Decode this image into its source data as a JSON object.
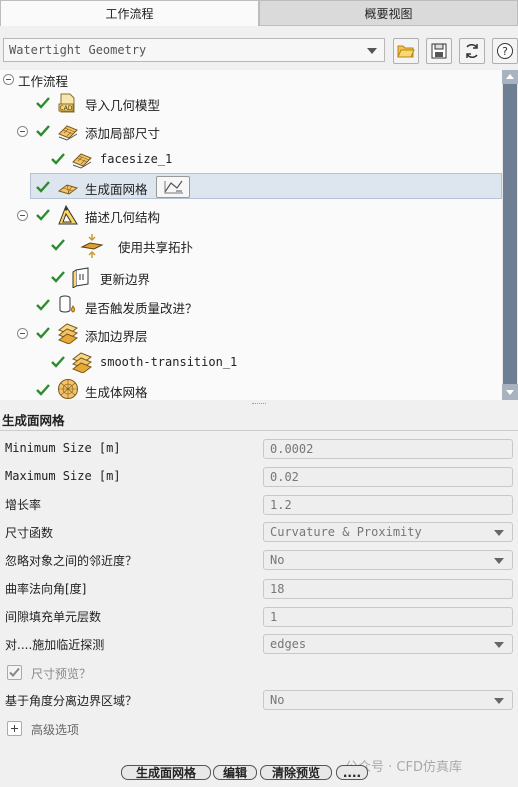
{
  "tabs": [
    {
      "label": "工作流程",
      "active": true
    },
    {
      "label": "概要视图",
      "active": false
    }
  ],
  "workflow_select": {
    "value": "Watertight Geometry"
  },
  "toolbar_icons": [
    "folder-open-icon",
    "save-icon",
    "refresh-icon",
    "help-icon"
  ],
  "tree": {
    "root": "工作流程",
    "items": [
      {
        "label": "导入几何模型",
        "icon": "cad-import-icon"
      },
      {
        "label": "添加局部尺寸",
        "icon": "local-size-icon"
      },
      {
        "label": "facesize_1",
        "icon": "local-size-icon"
      },
      {
        "label": "生成面网格",
        "icon": "surface-mesh-icon"
      },
      {
        "label": "描述几何结构",
        "icon": "describe-geometry-icon"
      },
      {
        "label": "使用共享拓扑",
        "icon": "share-topology-icon"
      },
      {
        "label": "更新边界",
        "icon": "update-boundaries-icon"
      },
      {
        "label": "是否触发质量改进？",
        "icon": "quality-improve-icon"
      },
      {
        "label": "添加边界层",
        "icon": "boundary-layer-icon"
      },
      {
        "label": "smooth-transition_1",
        "icon": "boundary-layer-icon"
      },
      {
        "label": "生成体网格",
        "icon": "volume-mesh-icon"
      }
    ]
  },
  "panel": {
    "title": "生成面网格",
    "props": [
      {
        "label": "Minimum Size [m]",
        "value": "0.0002",
        "dropdown": false
      },
      {
        "label": "Maximum Size [m]",
        "value": "0.02",
        "dropdown": false
      },
      {
        "label": "增长率",
        "value": "1.2",
        "dropdown": false
      },
      {
        "label": "尺寸函数",
        "value": "Curvature & Proximity",
        "dropdown": true
      },
      {
        "label": "忽略对象之间的邻近度？",
        "value": "No",
        "dropdown": true
      },
      {
        "label": "曲率法向角[度]",
        "value": "18",
        "dropdown": false
      },
      {
        "label": "间隙填充单元层数",
        "value": "1",
        "dropdown": false
      },
      {
        "label": "对....施加临近探测",
        "value": "edges",
        "dropdown": true
      }
    ],
    "size_preview_label": "尺寸预览？",
    "separate_label": "基于角度分离边界区域？",
    "separate_value": "No",
    "advanced_label": "高级选项"
  },
  "buttons": {
    "generate": "生成面网格",
    "edit": "编辑",
    "clear_preview": "清除预览",
    "more": "...."
  },
  "watermark": "公众号 · CFD仿真库"
}
